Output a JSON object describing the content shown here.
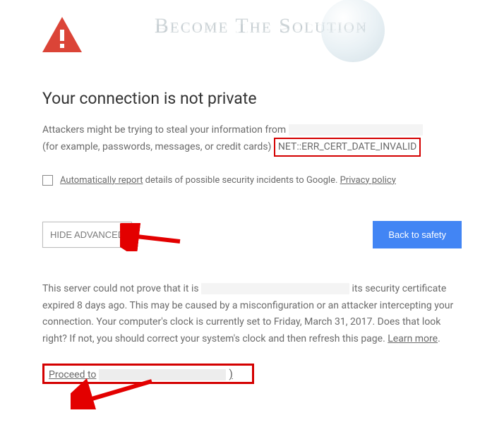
{
  "watermark": "Become The Solution",
  "heading": "Your connection is not private",
  "paragraph1_part1": "Attackers might be trying to steal your information from",
  "paragraph1_part2": "(for example, passwords, messages, or credit cards)",
  "error_code": "NET::ERR_CERT_DATE_INVALID",
  "auto_report_link": "Automatically report",
  "auto_report_text": " details of possible security incidents to Google. ",
  "privacy_link": "Privacy policy",
  "advanced_button": "HIDE ADVANCED",
  "safety_button": "Back to safety",
  "advanced_text_1": "This server could not prove that it is ",
  "advanced_text_2": " its security certificate expired 8 days ago. This may be caused by a misconfiguration or an attacker intercepting your connection. Your computer's clock is currently set to Friday, March 31, 2017. Does that look right? If not, you should correct your system's clock and then refresh this page. ",
  "learn_more": "Learn more",
  "proceed_text": "Proceed to",
  "proceed_suffix": ")"
}
